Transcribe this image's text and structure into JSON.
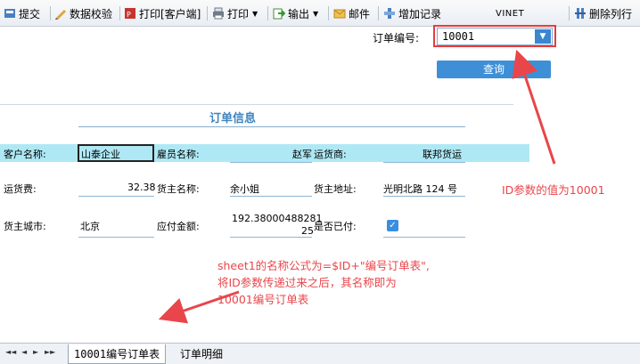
{
  "toolbar": {
    "submit": "提交",
    "data_check": "数据校验",
    "print_client": "打印[客户端]",
    "print": "打印",
    "export": "输出",
    "mail": "邮件",
    "add_record": "增加记录",
    "brand": "VINET",
    "delete_row": "删除列行"
  },
  "query": {
    "label": "订单编号:",
    "value": "10001",
    "button": "查询"
  },
  "report": {
    "title": "订单信息",
    "customer_label": "客户名称:",
    "customer_value": "山泰企业",
    "employee_label": "雇员名称:",
    "employee_value": "赵军",
    "shipper_label": "运货商:",
    "shipper_value": "联邦货运",
    "freight_label": "运货费:",
    "freight_value": "32.38",
    "owner_label": "货主名称:",
    "owner_value": "余小姐",
    "owner_address_label": "货主地址:",
    "owner_address_value": "光明北路 124 号",
    "owner_city_label": "货主城市:",
    "owner_city_value": "北京",
    "amount_label": "应付金额:",
    "amount_value_line1": "192.38000488281",
    "amount_value_line2": "25",
    "paid_label": "是否已付:",
    "paid_checked": true
  },
  "annotations": {
    "id_note": "ID参数的值为10001",
    "sheet_note_line1": "sheet1的名称公式为=$ID+\"编号订单表\",",
    "sheet_note_line2": "将ID参数传递过来之后，其名称即为",
    "sheet_note_line3": "10001编号订单表"
  },
  "sheets": {
    "nav": [
      "◄◄",
      "◄",
      "►",
      "►►"
    ],
    "tab1_prefix": "10001",
    "tab1_suffix": "编号订单表",
    "tab2": "订单明细"
  },
  "colors": {
    "accent": "#3e8fd6",
    "annotation": "#e8464b",
    "row_band": "#aee8f5"
  }
}
